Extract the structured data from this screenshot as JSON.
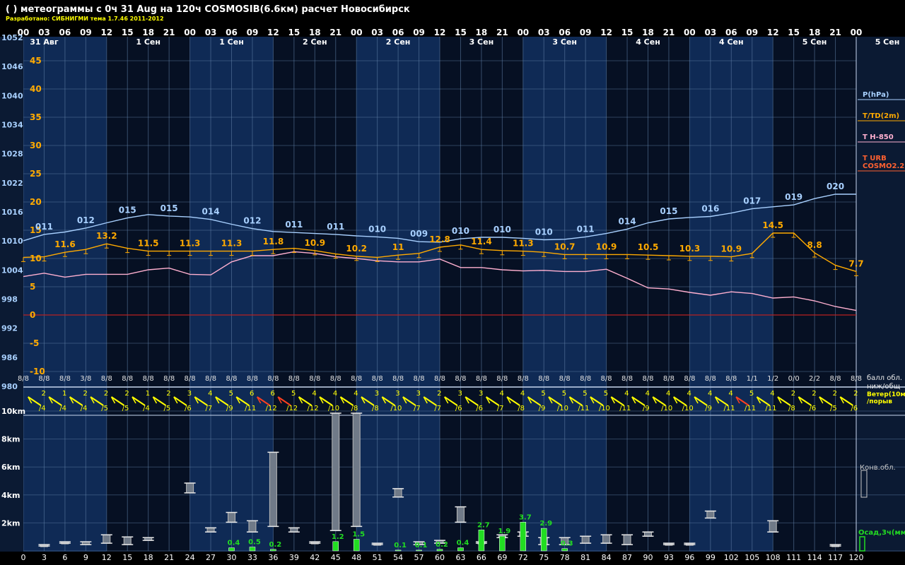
{
  "header": {
    "title": "( ) метеограммы с  0ч 31 Aug на 120ч COSMOSIB(6.6км) расчет Новосибирск",
    "subtitle": "Разработано: СИБНИГМИ тема 1.7.46 2011-2012"
  },
  "colors": {
    "background": "#0b1a33",
    "band_light": "#0f2a55",
    "band_dark": "#061023",
    "grid": "#5f7fa6",
    "pressure": "#a8d0ff",
    "temperature": "#ffaa00",
    "t850": "#ffb0d0",
    "zero_line": "#b82020",
    "wind": "#ffff00",
    "wind_strong": "#ff4020",
    "precip": "#22dd22",
    "cloud": "#b8b8b8"
  },
  "time_axis": {
    "hour_ticks": [
      "00",
      "03",
      "06",
      "09",
      "12",
      "15",
      "18",
      "21",
      "00",
      "03",
      "06",
      "09",
      "12",
      "15",
      "18",
      "21",
      "00",
      "03",
      "06",
      "09",
      "12",
      "15",
      "18",
      "21",
      "00",
      "03",
      "06",
      "09",
      "12",
      "15",
      "18",
      "21",
      "00",
      "03",
      "06",
      "09",
      "12",
      "15",
      "18",
      "21",
      "00"
    ],
    "date_labels": [
      {
        "h": 3,
        "text": "31 Авг"
      },
      {
        "h": 18,
        "text": "1 Сен"
      },
      {
        "h": 30,
        "text": "1 Сен"
      },
      {
        "h": 42,
        "text": "2 Сен"
      },
      {
        "h": 54,
        "text": "2 Сен"
      },
      {
        "h": 66,
        "text": "3 Сен"
      },
      {
        "h": 78,
        "text": "3 Сен"
      },
      {
        "h": 90,
        "text": "4 Сен"
      },
      {
        "h": 102,
        "text": "4 Сен"
      },
      {
        "h": 114,
        "text": "5 Сен"
      }
    ],
    "right_date_label": "5 Сен",
    "lead_hours": [
      "0",
      "3",
      "6",
      "9",
      "12",
      "15",
      "18",
      "21",
      "24",
      "27",
      "30",
      "33",
      "36",
      "39",
      "42",
      "45",
      "48",
      "51",
      "54",
      "57",
      "60",
      "63",
      "66",
      "69",
      "72",
      "75",
      "78",
      "81",
      "84",
      "87",
      "90",
      "93",
      "96",
      "99",
      "102",
      "105",
      "108",
      "111",
      "114",
      "117",
      "120"
    ]
  },
  "legend": {
    "pressure": "P(hPa)",
    "temperature": "T/TD(2m)",
    "t850": "T H-850",
    "t_urb": "T URB",
    "cosmo": "COSMO2.2",
    "cloud_label_1": "балл обл.",
    "cloud_label_2": "ниж/общ",
    "wind_label_1": "Ветер(10м",
    "wind_label_2": "/порыв",
    "conv_label": "Конв.обл.",
    "precip_label": "Осад,3ч(мм)"
  },
  "chart_data": {
    "type": "line",
    "title": "( ) метеограммы с  0ч 31 Aug на 120ч COSMOSIB(6.6км) расчет Новосибирск",
    "x_lead_hours": [
      0,
      3,
      6,
      9,
      12,
      15,
      18,
      21,
      24,
      27,
      30,
      33,
      36,
      39,
      42,
      45,
      48,
      51,
      54,
      57,
      60,
      63,
      66,
      69,
      72,
      75,
      78,
      81,
      84,
      87,
      90,
      93,
      96,
      99,
      102,
      105,
      108,
      111,
      114,
      117,
      120
    ],
    "pressure_axis": {
      "ticks": [
        "1052",
        "1046",
        "1040",
        "1034",
        "1028",
        "1022",
        "1016",
        "1010",
        "1004",
        "998",
        "992",
        "986",
        "980"
      ],
      "ylim": [
        980,
        1052
      ]
    },
    "temperature_axis": {
      "ticks": [
        "45",
        "40",
        "35",
        "30",
        "25",
        "20",
        "15",
        "10",
        "5",
        "0",
        "-5",
        "-10"
      ],
      "ylim": [
        -13,
        47
      ]
    },
    "series": [
      {
        "name": "P(hPa)",
        "values": [
          1009.9,
          1011.2,
          1011.7,
          1012.5,
          1013.6,
          1014.6,
          1015.3,
          1015.0,
          1014.8,
          1014.3,
          1013.3,
          1012.4,
          1011.8,
          1011.6,
          1011.4,
          1011.2,
          1010.9,
          1010.7,
          1010.4,
          1009.7,
          1009.6,
          1010.3,
          1010.6,
          1010.6,
          1010.4,
          1010.1,
          1010.2,
          1010.7,
          1011.4,
          1012.3,
          1013.6,
          1014.4,
          1014.7,
          1014.9,
          1015.6,
          1016.5,
          1016.9,
          1017.3,
          1018.6,
          1019.5,
          1019.5
        ]
      },
      {
        "name": "T/TD(2m)",
        "values": [
          10.2,
          10.3,
          11.1,
          11.6,
          12.6,
          11.8,
          11.3,
          11.3,
          11.3,
          11.3,
          11.3,
          11.3,
          11.6,
          11.8,
          11.4,
          10.8,
          10.4,
          10.2,
          10.6,
          10.9,
          12.0,
          12.4,
          11.6,
          11.4,
          11.3,
          11.1,
          10.7,
          10.7,
          10.7,
          10.7,
          10.6,
          10.5,
          10.4,
          10.4,
          10.3,
          10.9,
          14.5,
          14.5,
          11.0,
          8.8,
          7.7
        ]
      },
      {
        "name": "T H-850",
        "values": [
          6.8,
          7.4,
          6.7,
          7.2,
          7.2,
          7.2,
          8.0,
          8.3,
          7.2,
          7.1,
          9.4,
          10.5,
          10.5,
          11.2,
          10.9,
          10.3,
          10.0,
          9.6,
          9.4,
          9.4,
          9.9,
          8.4,
          8.4,
          8.0,
          7.8,
          7.9,
          7.7,
          7.7,
          8.1,
          6.5,
          4.8,
          4.6,
          4.0,
          3.5,
          4.1,
          3.8,
          3.0,
          3.2,
          2.5,
          1.5,
          0.8
        ]
      }
    ],
    "pressure_labels": [
      {
        "h": 3,
        "text": "011"
      },
      {
        "h": 9,
        "text": "012"
      },
      {
        "h": 15,
        "text": "015"
      },
      {
        "h": 21,
        "text": "015"
      },
      {
        "h": 27,
        "text": "014"
      },
      {
        "h": 33,
        "text": "012"
      },
      {
        "h": 39,
        "text": "011"
      },
      {
        "h": 45,
        "text": "011"
      },
      {
        "h": 51,
        "text": "010"
      },
      {
        "h": 57,
        "text": "009"
      },
      {
        "h": 63,
        "text": "010"
      },
      {
        "h": 69,
        "text": "010"
      },
      {
        "h": 75,
        "text": "010"
      },
      {
        "h": 81,
        "text": "011"
      },
      {
        "h": 87,
        "text": "014"
      },
      {
        "h": 93,
        "text": "015"
      },
      {
        "h": 99,
        "text": "016"
      },
      {
        "h": 105,
        "text": "017"
      },
      {
        "h": 111,
        "text": "019"
      },
      {
        "h": 117,
        "text": "020"
      }
    ],
    "temperature_labels": [
      {
        "h": 6,
        "text": "11.6"
      },
      {
        "h": 12,
        "text": "13.2"
      },
      {
        "h": 18,
        "text": "11.5"
      },
      {
        "h": 24,
        "text": "11.3"
      },
      {
        "h": 30,
        "text": "11.3"
      },
      {
        "h": 36,
        "text": "11.8"
      },
      {
        "h": 42,
        "text": "10.9"
      },
      {
        "h": 48,
        "text": "10.2"
      },
      {
        "h": 54,
        "text": "11"
      },
      {
        "h": 60,
        "text": "12.8"
      },
      {
        "h": 66,
        "text": "11.4"
      },
      {
        "h": 72,
        "text": "11.3"
      },
      {
        "h": 78,
        "text": "10.7"
      },
      {
        "h": 84,
        "text": "10.9"
      },
      {
        "h": 90,
        "text": "10.5"
      },
      {
        "h": 96,
        "text": "10.3"
      },
      {
        "h": 102,
        "text": "10.9"
      },
      {
        "h": 108,
        "text": "14.5"
      },
      {
        "h": 114,
        "text": "8.8"
      },
      {
        "h": 120,
        "text": "7.7"
      }
    ],
    "cloud_fraction": [
      "8/8",
      "8/8",
      "8/8",
      "3/8",
      "8/8",
      "8/8",
      "8/8",
      "8/8",
      "8/8",
      "8/8",
      "8/8",
      "8/8",
      "8/8",
      "8/8",
      "8/8",
      "8/8",
      "8/8",
      "8/8",
      "8/8",
      "8/8",
      "8/8",
      "8/8",
      "8/8",
      "8/8",
      "8/8",
      "8/8",
      "8/8",
      "8/8",
      "8/8",
      "8/8",
      "8/8",
      "8/8",
      "8/8",
      "8/8",
      "8/8",
      "1/1",
      "1/2",
      "0/0",
      "2/2",
      "8/8",
      "8/8"
    ],
    "wind": {
      "speed": [
        "2",
        "1",
        "2",
        "2",
        "2",
        "1",
        "2",
        "3",
        "4",
        "5",
        "6",
        "6",
        "5",
        "4",
        "4",
        "4",
        "3",
        "3",
        "3",
        "2",
        "3",
        "3",
        "4",
        "4",
        "5",
        "5",
        "5",
        "5",
        "4",
        "4",
        "4",
        "4",
        "4",
        "4",
        "5",
        "4",
        "2",
        "2",
        "2",
        "2"
      ],
      "gust": [
        "/4",
        "/4",
        "/4",
        "/5",
        "/5",
        "/4",
        "/5",
        "/6",
        "/7",
        "/9",
        "/11",
        "/12",
        "/12",
        "/12",
        "/10",
        "/8",
        "/8",
        "/10",
        "/7",
        "/7",
        "/6",
        "/6",
        "/7",
        "/8",
        "/9",
        "/10",
        "/11",
        "/10",
        "/11",
        "/9",
        "/10",
        "/10",
        "/9",
        "/11",
        "/11",
        "/11",
        "/8",
        "/6",
        "/5",
        "/6"
      ],
      "strong_indices": [
        11,
        12,
        34
      ]
    },
    "precip_axis": {
      "ticks": [
        "10km",
        "8km",
        "6km",
        "4km",
        "2km"
      ],
      "ylim": [
        0,
        10
      ]
    },
    "precip_3h_mm": [
      {
        "h": 30,
        "value": 0.4,
        "text": "0.4"
      },
      {
        "h": 33,
        "value": 0.5,
        "text": "0.5"
      },
      {
        "h": 36,
        "value": 0.2,
        "text": "0.2"
      },
      {
        "h": 45,
        "value": 1.2,
        "text": "1.2"
      },
      {
        "h": 48,
        "value": 1.5,
        "text": "1.5"
      },
      {
        "h": 54,
        "value": 0.1,
        "text": "0.1"
      },
      {
        "h": 57,
        "value": 0.1,
        "text": "0.1"
      },
      {
        "h": 60,
        "value": 0.2,
        "text": "0.2"
      },
      {
        "h": 63,
        "value": 0.4,
        "text": "0.4"
      },
      {
        "h": 66,
        "value": 2.7,
        "text": "2.7"
      },
      {
        "h": 69,
        "value": 1.9,
        "text": "1.9"
      },
      {
        "h": 72,
        "value": 3.7,
        "text": "3.7"
      },
      {
        "h": 75,
        "value": 2.9,
        "text": "2.9"
      },
      {
        "h": 78,
        "value": 0.3,
        "text": "0.3"
      }
    ],
    "convective_clouds_km": [
      {
        "h": 3,
        "base": 0.35,
        "top": 0.45
      },
      {
        "h": 6,
        "base": 0.55,
        "top": 0.65
      },
      {
        "h": 9,
        "base": 0.45,
        "top": 0.65
      },
      {
        "h": 12,
        "base": 0.55,
        "top": 1.15
      },
      {
        "h": 15,
        "base": 0.45,
        "top": 1.0
      },
      {
        "h": 18,
        "base": 0.75,
        "top": 0.95
      },
      {
        "h": 24,
        "base": 4.15,
        "top": 4.85
      },
      {
        "h": 27,
        "base": 1.35,
        "top": 1.65
      },
      {
        "h": 30,
        "base": 2.05,
        "top": 2.75
      },
      {
        "h": 33,
        "base": 1.35,
        "top": 2.15
      },
      {
        "h": 36,
        "base": 1.75,
        "top": 7.05
      },
      {
        "h": 39,
        "base": 1.35,
        "top": 1.65
      },
      {
        "h": 42,
        "base": 0.55,
        "top": 0.65
      },
      {
        "h": 45,
        "base": 1.45,
        "top": 9.85
      },
      {
        "h": 48,
        "base": 1.75,
        "top": 9.85
      },
      {
        "h": 51,
        "base": 0.45,
        "top": 0.55
      },
      {
        "h": 54,
        "base": 3.85,
        "top": 4.45
      },
      {
        "h": 57,
        "base": 0.45,
        "top": 0.65
      },
      {
        "h": 60,
        "base": 0.55,
        "top": 0.75
      },
      {
        "h": 63,
        "base": 2.05,
        "top": 3.15
      },
      {
        "h": 66,
        "base": 0.55,
        "top": 0.65
      },
      {
        "h": 69,
        "base": 0.95,
        "top": 1.15
      },
      {
        "h": 72,
        "base": 1.05,
        "top": 1.35
      },
      {
        "h": 75,
        "base": 0.45,
        "top": 0.95
      },
      {
        "h": 78,
        "base": 0.45,
        "top": 0.95
      },
      {
        "h": 81,
        "base": 0.55,
        "top": 1.05
      },
      {
        "h": 84,
        "base": 0.55,
        "top": 1.15
      },
      {
        "h": 87,
        "base": 0.45,
        "top": 1.15
      },
      {
        "h": 90,
        "base": 1.05,
        "top": 1.35
      },
      {
        "h": 93,
        "base": 0.45,
        "top": 0.55
      },
      {
        "h": 96,
        "base": 0.45,
        "top": 0.55
      },
      {
        "h": 99,
        "base": 2.35,
        "top": 2.85
      },
      {
        "h": 108,
        "base": 1.35,
        "top": 2.15
      },
      {
        "h": 117,
        "base": 0.35,
        "top": 0.45
      }
    ]
  }
}
